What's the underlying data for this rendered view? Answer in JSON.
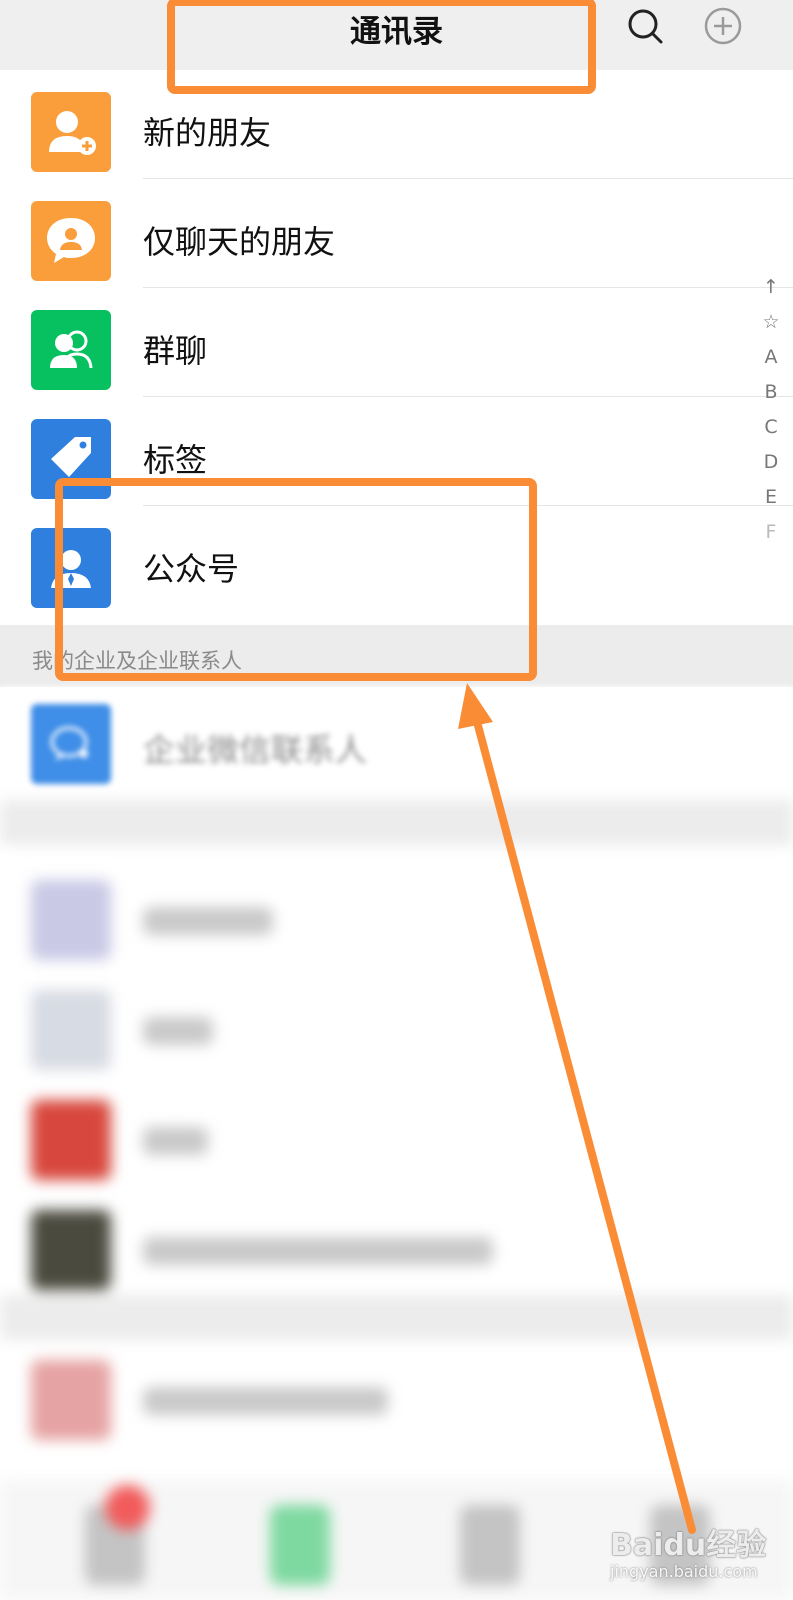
{
  "header": {
    "title": "通讯录",
    "search_icon": "search-icon",
    "add_icon": "plus-circle-icon"
  },
  "items": [
    {
      "label": "新的朋友",
      "icon": "add-friend-icon",
      "color": "#fa9d3b"
    },
    {
      "label": "仅聊天的朋友",
      "icon": "chat-only-friend-icon",
      "color": "#fa9d3b"
    },
    {
      "label": "群聊",
      "icon": "group-chat-icon",
      "color": "#07c160"
    },
    {
      "label": "标签",
      "icon": "tag-icon",
      "color": "#2f80de"
    },
    {
      "label": "公众号",
      "icon": "official-account-icon",
      "color": "#2f80de"
    }
  ],
  "section": {
    "label": "我的企业及企业联系人"
  },
  "enterprise": {
    "label": "企业微信联系人",
    "icon": "work-wechat-icon",
    "color": "#3f8ee8"
  },
  "alpha_index": [
    "↑",
    "☆",
    "A",
    "B",
    "C",
    "D",
    "E",
    "F"
  ],
  "annotation": {
    "color": "#fa8c35"
  },
  "watermark": {
    "brand": "Baidu经验",
    "url": "jingyan.baidu.com"
  }
}
